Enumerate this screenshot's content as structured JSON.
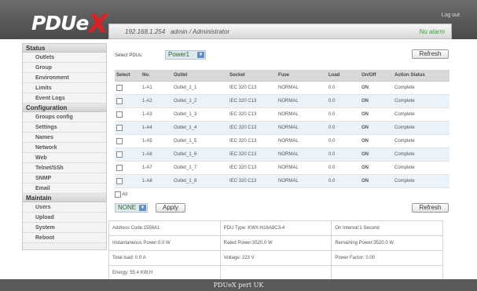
{
  "header": {
    "logo_text": "PDUe",
    "logo_x": "X",
    "logout": "Log out",
    "ip": "192.168.1.254",
    "user": "admin / Administrator",
    "alarm": "No alarm"
  },
  "sidebar": {
    "status_title": "Status",
    "status_items": [
      "Outlets",
      "Group",
      "Environment",
      "Limits",
      "Event Logs"
    ],
    "config_title": "Configuration",
    "config_items": [
      "Groups config",
      "Settings",
      "Names",
      "Network",
      "Web",
      "Telnet/SSh",
      "SNMP",
      "Email"
    ],
    "maintain_title": "Maintain",
    "maintain_items": [
      "Users",
      "Upload",
      "System",
      "Reboot"
    ]
  },
  "controls": {
    "select_label": "Select PDUs:",
    "pdu_selected": "Power1",
    "refresh": "Refresh",
    "all_label": "All",
    "action_selected": "NONE",
    "apply": "Apply"
  },
  "table": {
    "headers": [
      "Select",
      "No.",
      "Outlet",
      "Socket",
      "Fuse",
      "Load",
      "On/Off",
      "Action Status"
    ],
    "rows": [
      {
        "no": "1-A1",
        "outlet": "Outlet_1_1",
        "socket": "IEC 320 C13",
        "fuse": "NORMAL",
        "load": "0.0",
        "state": "ON",
        "status": "Complete"
      },
      {
        "no": "1-A2",
        "outlet": "Outlet_1_2",
        "socket": "IEC 320 C13",
        "fuse": "NORMAL",
        "load": "0.0",
        "state": "ON",
        "status": "Complete"
      },
      {
        "no": "1-A3",
        "outlet": "Outlet_1_3",
        "socket": "IEC 320 C13",
        "fuse": "NORMAL",
        "load": "0.0",
        "state": "ON",
        "status": "Complete"
      },
      {
        "no": "1-A4",
        "outlet": "Outlet_1_4",
        "socket": "IEC 320 C13",
        "fuse": "NORMAL",
        "load": "0.0",
        "state": "ON",
        "status": "Complete"
      },
      {
        "no": "1-A5",
        "outlet": "Outlet_1_5",
        "socket": "IEC 320 C13",
        "fuse": "NORMAL",
        "load": "0.0",
        "state": "ON",
        "status": "Complete"
      },
      {
        "no": "1-A6",
        "outlet": "Outlet_1_6",
        "socket": "IEC 320 C13",
        "fuse": "NORMAL",
        "load": "0.0",
        "state": "ON",
        "status": "Complete"
      },
      {
        "no": "1-A7",
        "outlet": "Outlet_1_7",
        "socket": "IEC 320 C13",
        "fuse": "NORMAL",
        "load": "0.0",
        "state": "ON",
        "status": "Complete"
      },
      {
        "no": "1-A8",
        "outlet": "Outlet_1_8",
        "socket": "IEC 320 C13",
        "fuse": "NORMAL",
        "load": "0.0",
        "state": "ON",
        "status": "Complete"
      }
    ]
  },
  "info": {
    "address": "Address Code:1556A1",
    "pdu_type": "PDU Type: KWX-N16A8C3-4",
    "on_interval": "On Interval:1 Second",
    "instant_power": "Instantaneous Power:0.0 W",
    "rated_power": "Rated Power:3520.0 W",
    "remaining_power": "Remaining Power:3520.0 W",
    "total_load": "Total load: 0.0 A",
    "voltage": "Voltage: 223 V",
    "power_factor": "Power Factor: 0.00",
    "energy": "Energy: 55.4 KW.H"
  },
  "footer": {
    "text": "PDUeX pert UK"
  },
  "colors": {
    "on": "#2a9a2a",
    "alarm": "#3aa032",
    "logo_x": "#e02020"
  }
}
